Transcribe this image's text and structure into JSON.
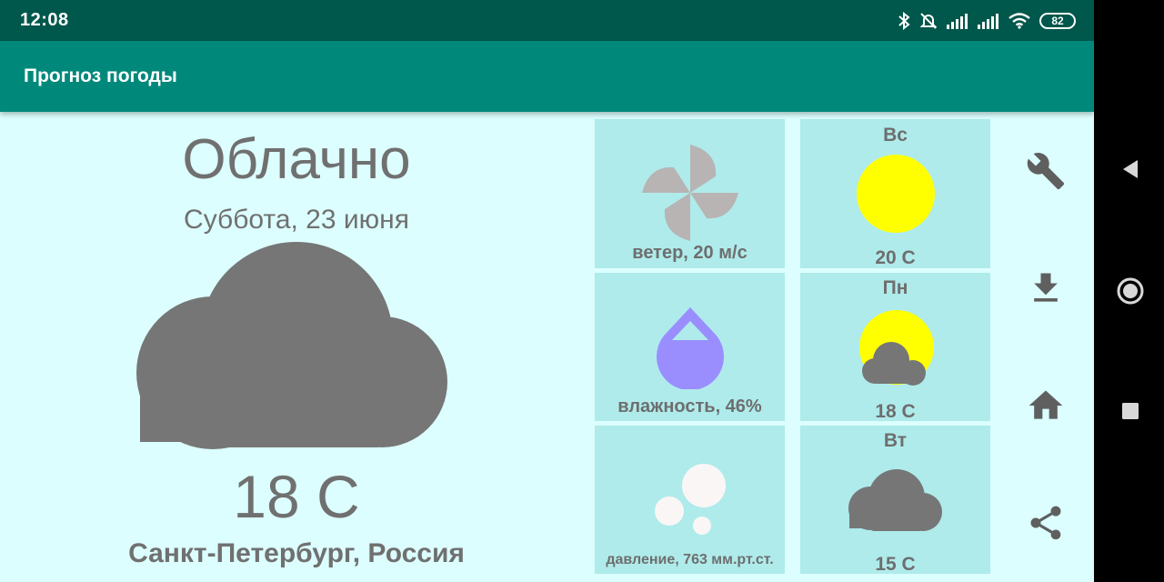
{
  "status": {
    "time": "12:08",
    "battery": "82"
  },
  "toolbar": {
    "title": "Прогноз погоды"
  },
  "current": {
    "condition": "Облачно",
    "date": "Суббота, 23 июня",
    "temperature": "18 C",
    "city": "Санкт-Петербург, Россия",
    "icon": "cloud-icon"
  },
  "details": [
    {
      "label": "ветер, 20 м/с",
      "icon": "wind-icon"
    },
    {
      "label": "влажность, 46%",
      "icon": "humidity-icon"
    },
    {
      "label": "давление, 763 мм.рт.ст.",
      "icon": "pressure-icon"
    }
  ],
  "forecast": [
    {
      "day": "Вс",
      "temp": "20 C",
      "icon": "sun-icon"
    },
    {
      "day": "Пн",
      "temp": "18 C",
      "icon": "partly-cloudy-icon"
    },
    {
      "day": "Вт",
      "temp": "15 C",
      "icon": "cloud-icon"
    }
  ],
  "actions": [
    "settings-icon",
    "download-icon",
    "home-icon",
    "share-icon"
  ],
  "colors": {
    "status_bar": "#00574b",
    "toolbar": "#00897b",
    "background": "#dcfefe",
    "tile": "#afebeb",
    "text": "#707070",
    "sun": "#ffff00",
    "cloud": "#767676",
    "water": "#9a8eff"
  }
}
